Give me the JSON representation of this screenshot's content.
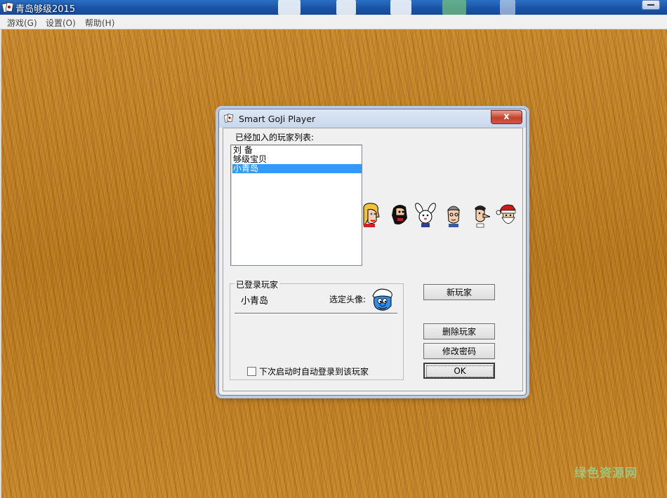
{
  "window": {
    "title": "青岛够级2015"
  },
  "menu": {
    "items": [
      "游戏(G)",
      "设置(O)",
      "帮助(H)"
    ]
  },
  "dialog": {
    "title": "Smart GoJi Player",
    "close_label": "x",
    "joined_label": "已经加入的玩家列表:",
    "players": [
      "刘 备",
      "够级宝贝",
      "小青岛"
    ],
    "selected_player_index": 2,
    "avatars": [
      "blonde-girl-avatar-icon",
      "bearded-man-avatar-icon",
      "rabbit-avatar-icon",
      "old-man-avatar-icon",
      "long-nose-man-avatar-icon",
      "santa-avatar-icon"
    ],
    "logged_in": {
      "legend": "已登录玩家",
      "name": "小青岛",
      "avatar_label": "选定头像:",
      "auto_login_label": "下次启动时自动登录到该玩家",
      "auto_login_checked": false
    },
    "buttons": {
      "new": "新玩家",
      "delete": "删除玩家",
      "change_password": "修改密码",
      "ok": "OK"
    }
  },
  "watermark": "绿色资源网",
  "colors": {
    "selection": "#3399ff",
    "desktop": "#c07f27",
    "titlebar": "#1a54a8"
  }
}
